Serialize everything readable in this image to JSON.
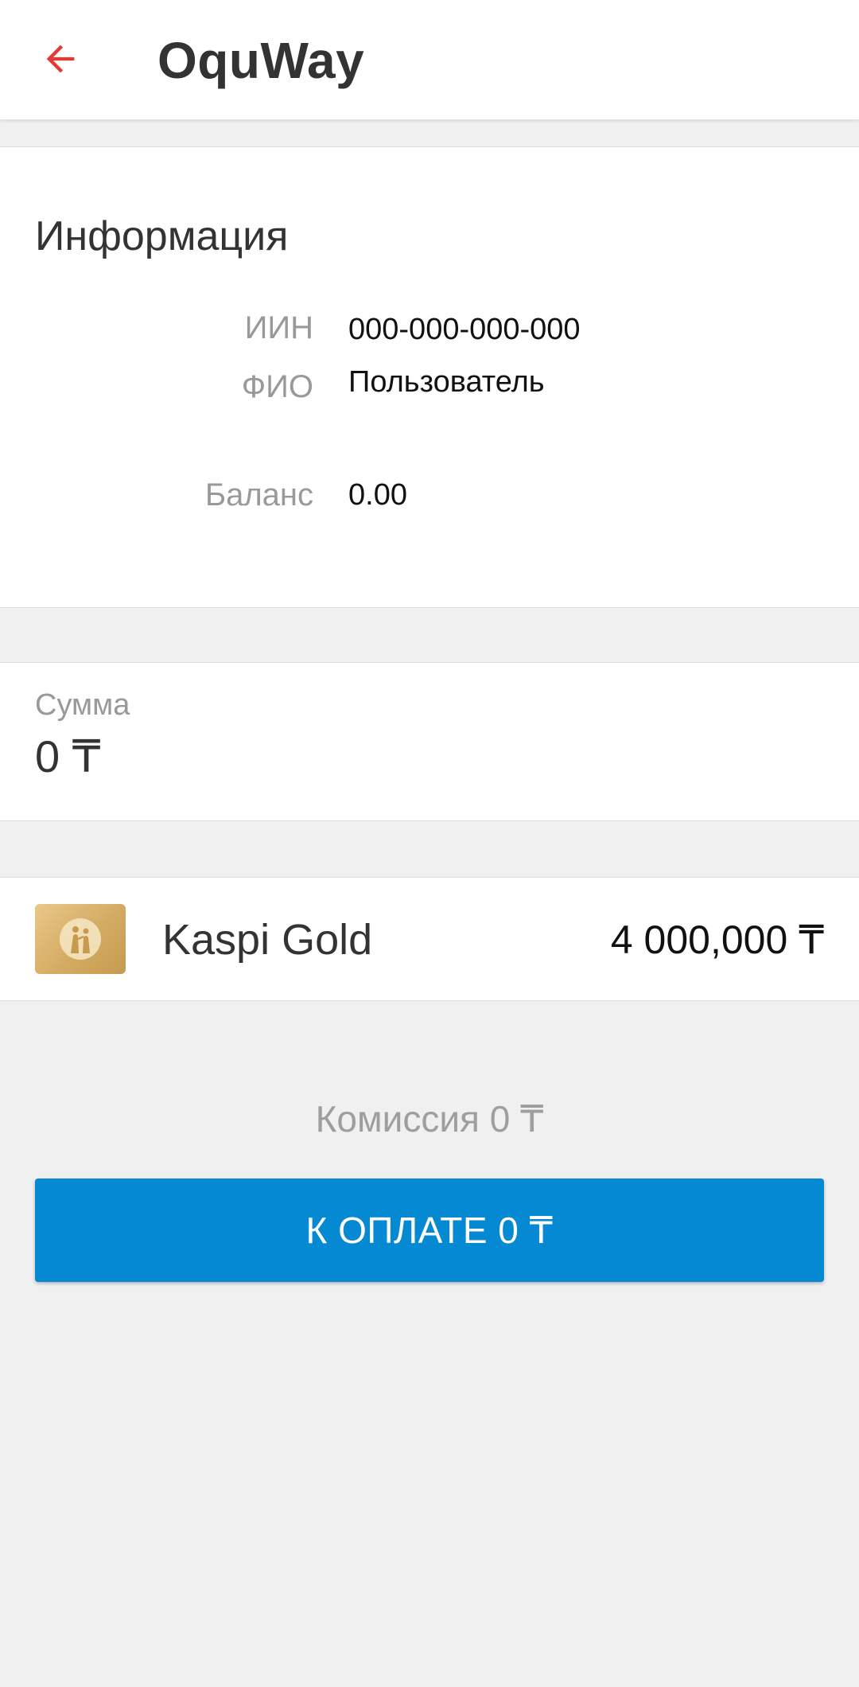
{
  "app_bar": {
    "back_icon": "arrow-left-icon",
    "title": "OquWay",
    "accent_color": "#E53935"
  },
  "info": {
    "title": "Информация",
    "iin_label": "ИИН",
    "iin_value": "000-000-000-000",
    "name_label": "ФИО",
    "name_value": "Пользователь",
    "balance_label": "Баланс",
    "balance_value": "0.00"
  },
  "amount": {
    "label": "Сумма",
    "value": "0 ₸"
  },
  "payment_card": {
    "icon": "kaspi-gold-card-icon",
    "name": "Kaspi Gold",
    "balance": "4 000,000 ₸",
    "color": "#D4AB63"
  },
  "commission": "Комиссия 0 ₸",
  "pay_button": {
    "label": "К ОПЛАТЕ 0 ₸",
    "color": "#0589D2"
  }
}
